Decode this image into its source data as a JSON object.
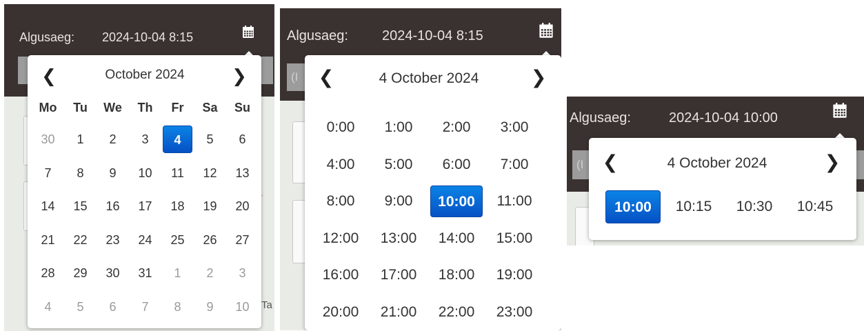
{
  "panel1": {
    "label": "Algusaeg:",
    "value": "2024-10-04 8:15",
    "picker": {
      "prev_icon": "chevron-left-icon",
      "next_icon": "chevron-right-icon",
      "title": "October 2024",
      "weekdays": [
        "Mo",
        "Tu",
        "We",
        "Th",
        "Fr",
        "Sa",
        "Su"
      ],
      "weeks": [
        [
          {
            "d": "30",
            "muted": true
          },
          {
            "d": "1"
          },
          {
            "d": "2"
          },
          {
            "d": "3"
          },
          {
            "d": "4",
            "selected": true
          },
          {
            "d": "5"
          },
          {
            "d": "6"
          }
        ],
        [
          {
            "d": "7"
          },
          {
            "d": "8"
          },
          {
            "d": "9"
          },
          {
            "d": "10"
          },
          {
            "d": "11"
          },
          {
            "d": "12"
          },
          {
            "d": "13"
          }
        ],
        [
          {
            "d": "14"
          },
          {
            "d": "15"
          },
          {
            "d": "16"
          },
          {
            "d": "17"
          },
          {
            "d": "18"
          },
          {
            "d": "19"
          },
          {
            "d": "20"
          }
        ],
        [
          {
            "d": "21"
          },
          {
            "d": "22"
          },
          {
            "d": "23"
          },
          {
            "d": "24"
          },
          {
            "d": "25"
          },
          {
            "d": "26"
          },
          {
            "d": "27"
          }
        ],
        [
          {
            "d": "28"
          },
          {
            "d": "29"
          },
          {
            "d": "30"
          },
          {
            "d": "31"
          },
          {
            "d": "1",
            "muted": true
          },
          {
            "d": "2",
            "muted": true
          },
          {
            "d": "3",
            "muted": true
          }
        ],
        [
          {
            "d": "4",
            "muted": true
          },
          {
            "d": "5",
            "muted": true
          },
          {
            "d": "6",
            "muted": true
          },
          {
            "d": "7",
            "muted": true
          },
          {
            "d": "8",
            "muted": true
          },
          {
            "d": "9",
            "muted": true
          },
          {
            "d": "10",
            "muted": true
          }
        ]
      ]
    },
    "map_text": "Ta"
  },
  "panel2": {
    "label": "Algusaeg:",
    "value": "2024-10-04 8:15",
    "field_fragment": "(I",
    "picker": {
      "prev_icon": "chevron-left-icon",
      "next_icon": "chevron-right-icon",
      "title": "4 October 2024",
      "hours": [
        [
          "0:00",
          "1:00",
          "2:00",
          "3:00"
        ],
        [
          "4:00",
          "5:00",
          "6:00",
          "7:00"
        ],
        [
          "8:00",
          "9:00",
          "10:00",
          "11:00"
        ],
        [
          "12:00",
          "13:00",
          "14:00",
          "15:00"
        ],
        [
          "16:00",
          "17:00",
          "18:00",
          "19:00"
        ],
        [
          "20:00",
          "21:00",
          "22:00",
          "23:00"
        ]
      ],
      "selected_hour": "10:00"
    }
  },
  "panel3": {
    "label": "Algusaeg:",
    "value": "2024-10-04 10:00",
    "field_fragment": "(I",
    "picker": {
      "prev_icon": "chevron-left-icon",
      "next_icon": "chevron-right-icon",
      "title": "4 October 2024",
      "minutes": [
        "10:00",
        "10:15",
        "10:30",
        "10:45"
      ],
      "selected_minute": "10:00"
    }
  },
  "colors": {
    "header_bg": "#3a3230",
    "header_text": "#e8e3e0",
    "selected_bg": "#0a6fd8",
    "muted_day": "#9a9a9a"
  }
}
